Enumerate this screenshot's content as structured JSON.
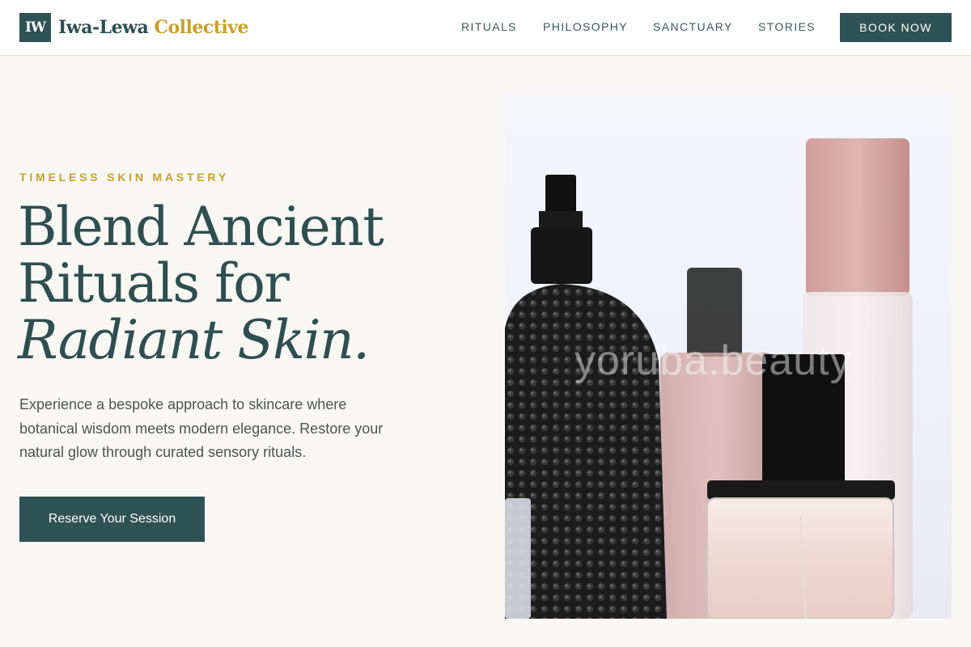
{
  "brand": {
    "mark": "IW",
    "name_primary": "Iwa-Lewa",
    "name_accent": "Collective"
  },
  "nav": {
    "items": [
      {
        "label": "RITUALS"
      },
      {
        "label": "PHILOSOPHY"
      },
      {
        "label": "SANCTUARY"
      },
      {
        "label": "STORIES"
      }
    ],
    "book_label": "BOOK NOW"
  },
  "hero": {
    "eyebrow": "TIMELESS SKIN MASTERY",
    "headline_line1": "Blend Ancient",
    "headline_line2": "Rituals for",
    "headline_italic": "Radiant Skin.",
    "lede": "Experience a bespoke approach to skincare where botanical wisdom meets modern elegance. Restore your natural glow through curated sensory rituals.",
    "cta_label": "Reserve Your Session",
    "image_watermark": "yoruba.beauty"
  },
  "colors": {
    "primary": "#2f5254",
    "accent": "#c9a028",
    "background": "#f9f7f3"
  }
}
